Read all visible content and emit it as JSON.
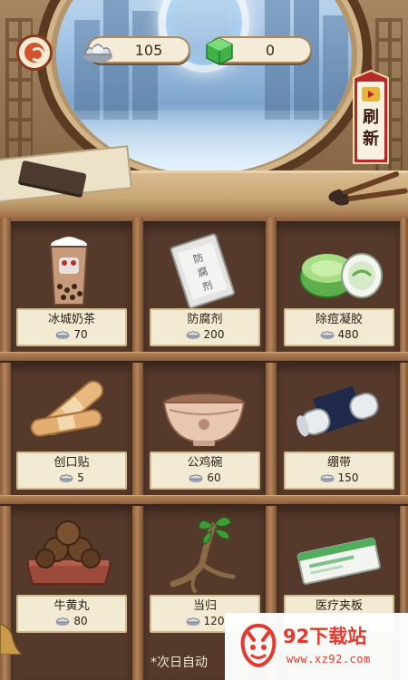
{
  "hud": {
    "silver_amount": "105",
    "jade_amount": "0",
    "refresh_label": "刷新"
  },
  "shop": {
    "items": [
      {
        "name": "冰城奶茶",
        "price": "70",
        "icon": "milk-tea"
      },
      {
        "name": "防腐剂",
        "price": "200",
        "icon": "preservative-packet"
      },
      {
        "name": "除痘凝胶",
        "price": "480",
        "icon": "acne-gel-jar"
      },
      {
        "name": "创口贴",
        "price": "5",
        "icon": "band-aid"
      },
      {
        "name": "公鸡碗",
        "price": "60",
        "icon": "rooster-bowl"
      },
      {
        "name": "绷带",
        "price": "150",
        "icon": "bandage-roll"
      },
      {
        "name": "牛黄丸",
        "price": "80",
        "icon": "bezoar-pills"
      },
      {
        "name": "当归",
        "price": "120",
        "icon": "angelica-root"
      },
      {
        "name": "医疗夹板",
        "price": "",
        "icon": "medical-splint"
      }
    ]
  },
  "notice": "*次日自动",
  "watermark": {
    "title": "92下载站",
    "url": "www.xz92.com"
  },
  "colors": {
    "shelf_wood": "#b5855a",
    "shelf_dark": "#4a3022",
    "label_paper": "#f3ead3",
    "refresh_red": "#b7282c",
    "watermark_red": "#e23a2e"
  }
}
